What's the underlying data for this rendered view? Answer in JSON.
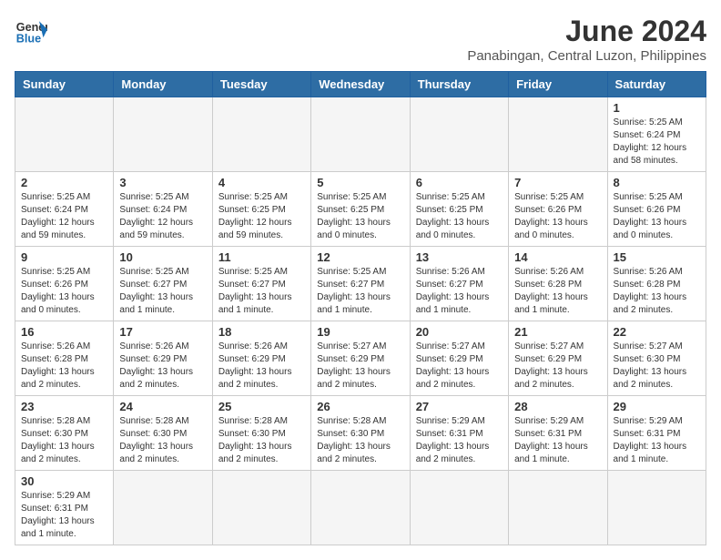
{
  "logo": {
    "general": "General",
    "blue": "Blue"
  },
  "title": "June 2024",
  "subtitle": "Panabingan, Central Luzon, Philippines",
  "days_of_week": [
    "Sunday",
    "Monday",
    "Tuesday",
    "Wednesday",
    "Thursday",
    "Friday",
    "Saturday"
  ],
  "weeks": [
    [
      {
        "day": "",
        "info": "",
        "empty": true
      },
      {
        "day": "",
        "info": "",
        "empty": true
      },
      {
        "day": "",
        "info": "",
        "empty": true
      },
      {
        "day": "",
        "info": "",
        "empty": true
      },
      {
        "day": "",
        "info": "",
        "empty": true
      },
      {
        "day": "",
        "info": "",
        "empty": true
      },
      {
        "day": "1",
        "info": "Sunrise: 5:25 AM\nSunset: 6:24 PM\nDaylight: 12 hours\nand 58 minutes.",
        "empty": false
      }
    ],
    [
      {
        "day": "2",
        "info": "Sunrise: 5:25 AM\nSunset: 6:24 PM\nDaylight: 12 hours\nand 59 minutes.",
        "empty": false
      },
      {
        "day": "3",
        "info": "Sunrise: 5:25 AM\nSunset: 6:24 PM\nDaylight: 12 hours\nand 59 minutes.",
        "empty": false
      },
      {
        "day": "4",
        "info": "Sunrise: 5:25 AM\nSunset: 6:25 PM\nDaylight: 12 hours\nand 59 minutes.",
        "empty": false
      },
      {
        "day": "5",
        "info": "Sunrise: 5:25 AM\nSunset: 6:25 PM\nDaylight: 13 hours\nand 0 minutes.",
        "empty": false
      },
      {
        "day": "6",
        "info": "Sunrise: 5:25 AM\nSunset: 6:25 PM\nDaylight: 13 hours\nand 0 minutes.",
        "empty": false
      },
      {
        "day": "7",
        "info": "Sunrise: 5:25 AM\nSunset: 6:26 PM\nDaylight: 13 hours\nand 0 minutes.",
        "empty": false
      },
      {
        "day": "8",
        "info": "Sunrise: 5:25 AM\nSunset: 6:26 PM\nDaylight: 13 hours\nand 0 minutes.",
        "empty": false
      }
    ],
    [
      {
        "day": "9",
        "info": "Sunrise: 5:25 AM\nSunset: 6:26 PM\nDaylight: 13 hours\nand 0 minutes.",
        "empty": false
      },
      {
        "day": "10",
        "info": "Sunrise: 5:25 AM\nSunset: 6:27 PM\nDaylight: 13 hours\nand 1 minute.",
        "empty": false
      },
      {
        "day": "11",
        "info": "Sunrise: 5:25 AM\nSunset: 6:27 PM\nDaylight: 13 hours\nand 1 minute.",
        "empty": false
      },
      {
        "day": "12",
        "info": "Sunrise: 5:25 AM\nSunset: 6:27 PM\nDaylight: 13 hours\nand 1 minute.",
        "empty": false
      },
      {
        "day": "13",
        "info": "Sunrise: 5:26 AM\nSunset: 6:27 PM\nDaylight: 13 hours\nand 1 minute.",
        "empty": false
      },
      {
        "day": "14",
        "info": "Sunrise: 5:26 AM\nSunset: 6:28 PM\nDaylight: 13 hours\nand 1 minute.",
        "empty": false
      },
      {
        "day": "15",
        "info": "Sunrise: 5:26 AM\nSunset: 6:28 PM\nDaylight: 13 hours\nand 2 minutes.",
        "empty": false
      }
    ],
    [
      {
        "day": "16",
        "info": "Sunrise: 5:26 AM\nSunset: 6:28 PM\nDaylight: 13 hours\nand 2 minutes.",
        "empty": false
      },
      {
        "day": "17",
        "info": "Sunrise: 5:26 AM\nSunset: 6:29 PM\nDaylight: 13 hours\nand 2 minutes.",
        "empty": false
      },
      {
        "day": "18",
        "info": "Sunrise: 5:26 AM\nSunset: 6:29 PM\nDaylight: 13 hours\nand 2 minutes.",
        "empty": false
      },
      {
        "day": "19",
        "info": "Sunrise: 5:27 AM\nSunset: 6:29 PM\nDaylight: 13 hours\nand 2 minutes.",
        "empty": false
      },
      {
        "day": "20",
        "info": "Sunrise: 5:27 AM\nSunset: 6:29 PM\nDaylight: 13 hours\nand 2 minutes.",
        "empty": false
      },
      {
        "day": "21",
        "info": "Sunrise: 5:27 AM\nSunset: 6:29 PM\nDaylight: 13 hours\nand 2 minutes.",
        "empty": false
      },
      {
        "day": "22",
        "info": "Sunrise: 5:27 AM\nSunset: 6:30 PM\nDaylight: 13 hours\nand 2 minutes.",
        "empty": false
      }
    ],
    [
      {
        "day": "23",
        "info": "Sunrise: 5:28 AM\nSunset: 6:30 PM\nDaylight: 13 hours\nand 2 minutes.",
        "empty": false
      },
      {
        "day": "24",
        "info": "Sunrise: 5:28 AM\nSunset: 6:30 PM\nDaylight: 13 hours\nand 2 minutes.",
        "empty": false
      },
      {
        "day": "25",
        "info": "Sunrise: 5:28 AM\nSunset: 6:30 PM\nDaylight: 13 hours\nand 2 minutes.",
        "empty": false
      },
      {
        "day": "26",
        "info": "Sunrise: 5:28 AM\nSunset: 6:30 PM\nDaylight: 13 hours\nand 2 minutes.",
        "empty": false
      },
      {
        "day": "27",
        "info": "Sunrise: 5:29 AM\nSunset: 6:31 PM\nDaylight: 13 hours\nand 2 minutes.",
        "empty": false
      },
      {
        "day": "28",
        "info": "Sunrise: 5:29 AM\nSunset: 6:31 PM\nDaylight: 13 hours\nand 1 minute.",
        "empty": false
      },
      {
        "day": "29",
        "info": "Sunrise: 5:29 AM\nSunset: 6:31 PM\nDaylight: 13 hours\nand 1 minute.",
        "empty": false
      }
    ],
    [
      {
        "day": "30",
        "info": "Sunrise: 5:29 AM\nSunset: 6:31 PM\nDaylight: 13 hours\nand 1 minute.",
        "empty": false
      },
      {
        "day": "",
        "info": "",
        "empty": true
      },
      {
        "day": "",
        "info": "",
        "empty": true
      },
      {
        "day": "",
        "info": "",
        "empty": true
      },
      {
        "day": "",
        "info": "",
        "empty": true
      },
      {
        "day": "",
        "info": "",
        "empty": true
      },
      {
        "day": "",
        "info": "",
        "empty": true
      }
    ]
  ]
}
